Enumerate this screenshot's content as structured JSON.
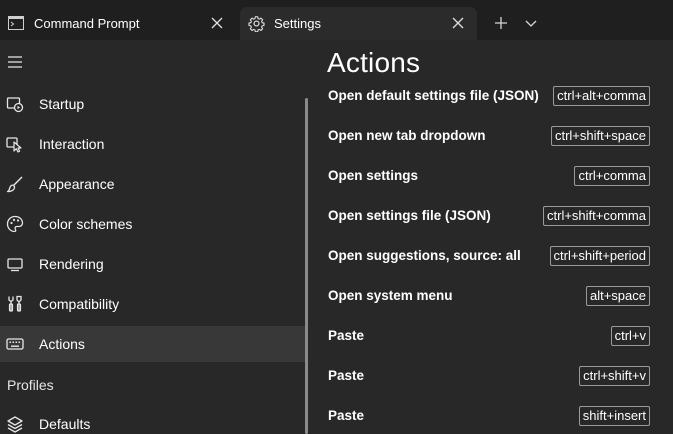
{
  "tabs": [
    {
      "title": "Command Prompt",
      "icon": "terminal-icon",
      "active": false
    },
    {
      "title": "Settings",
      "icon": "gear-icon",
      "active": true
    }
  ],
  "tabbar": {
    "new_tab_icon": "plus-icon",
    "dropdown_icon": "chevron-down-icon"
  },
  "nav": {
    "menu_icon": "hamburger-icon",
    "items": [
      {
        "label": "Startup",
        "icon": "startup-icon"
      },
      {
        "label": "Interaction",
        "icon": "interaction-icon"
      },
      {
        "label": "Appearance",
        "icon": "paintbrush-icon"
      },
      {
        "label": "Color schemes",
        "icon": "palette-icon"
      },
      {
        "label": "Rendering",
        "icon": "monitor-icon"
      },
      {
        "label": "Compatibility",
        "icon": "wrench-icon"
      },
      {
        "label": "Actions",
        "icon": "keyboard-icon",
        "selected": true
      }
    ],
    "profiles_header": "Profiles",
    "profile_items": [
      {
        "label": "Defaults",
        "icon": "layers-icon"
      }
    ]
  },
  "content": {
    "title": "Actions",
    "actions": [
      {
        "name": "Open default settings file (JSON)",
        "keys": "ctrl+alt+comma"
      },
      {
        "name": "Open new tab dropdown",
        "keys": "ctrl+shift+space"
      },
      {
        "name": "Open settings",
        "keys": "ctrl+comma"
      },
      {
        "name": "Open settings file (JSON)",
        "keys": "ctrl+shift+comma"
      },
      {
        "name": "Open suggestions, source: all",
        "keys": "ctrl+shift+period"
      },
      {
        "name": "Open system menu",
        "keys": "alt+space"
      },
      {
        "name": "Paste",
        "keys": "ctrl+v"
      },
      {
        "name": "Paste",
        "keys": "ctrl+shift+v"
      },
      {
        "name": "Paste",
        "keys": "shift+insert"
      }
    ]
  },
  "colors": {
    "tabbar_bg": "#1f1f1f",
    "active_tab_bg": "#2b2b2b",
    "nav_bg": "#282828",
    "selected_item_bg": "#383838",
    "keychord_border": "#9a9a9a"
  }
}
